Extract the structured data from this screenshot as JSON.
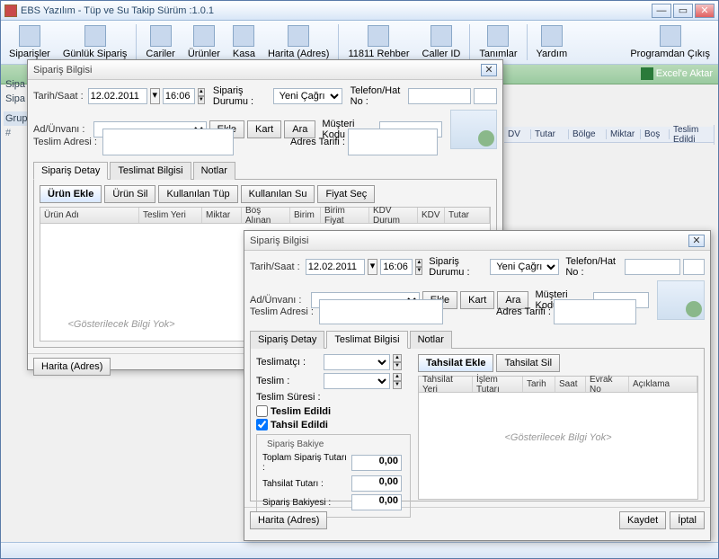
{
  "app": {
    "title": "EBS Yazılım - Tüp ve Su Takip Sürüm :1.0.1"
  },
  "toolbar": {
    "items": [
      "Siparişler",
      "Günlük Sipariş",
      "Cariler",
      "Ürünler",
      "Kasa",
      "Harita (Adres)",
      "11811 Rehber",
      "Caller ID",
      "Tanımlar",
      "Yardım"
    ],
    "rightItem": "Programdan Çıkış",
    "excelExport": "Excel'e Aktar"
  },
  "sidebar": {
    "rows": [
      "Sipa",
      "Sipa",
      "Grup"
    ],
    "hash": "#"
  },
  "gridColumns": [
    "DV",
    "Tutar",
    "Bölge",
    "Miktar",
    "Boş",
    "Teslim Edildi"
  ],
  "orderDialog": {
    "title": "Sipariş Bilgisi",
    "labels": {
      "dateTime": "Tarih/Saat :",
      "nameTitle": "Ad/Ünvanı :",
      "deliveryAddr": "Teslim Adresi :",
      "orderStatus": "Sipariş Durumu :",
      "phone": "Telefon/Hat No :",
      "customerCode": "Müşteri Kodu :",
      "addressDesc": "Adres Tarifi :"
    },
    "date": "12.02.2011",
    "time": "16:06",
    "status": "Yeni Çağrı",
    "btns": {
      "add": "Ekle",
      "card": "Kart",
      "search": "Ara"
    },
    "tabs": [
      "Sipariş Detay",
      "Teslimat Bilgisi",
      "Notlar"
    ],
    "detailBtns": [
      "Ürün Ekle",
      "Ürün Sil",
      "Kullanılan Tüp",
      "Kullanılan Su",
      "Fiyat Seç"
    ],
    "detailCols": [
      "Ürün Adı",
      "Teslim Yeri",
      "Miktar",
      "Boş Alınan",
      "Birim",
      "Birim Fiyat",
      "KDV Durum",
      "KDV",
      "Tutar"
    ],
    "noData": "<Gösterilecek Bilgi Yok>",
    "footerBtn": "Harita (Adres)"
  },
  "deliveryDialog": {
    "title": "Sipariş Bilgisi",
    "activeTab": "Teslimat Bilgisi",
    "labels": {
      "courier": "Teslimatçı :",
      "delivery": "Teslim :",
      "duration": "Teslim Süresi :",
      "delivered": "Teslim Edildi",
      "collected": "Tahsil Edildi",
      "balanceTitle": "Sipariş Bakiye",
      "totalOrder": "Toplam Sipariş Tutarı :",
      "collectAmt": "Tahsilat Tutarı :",
      "orderBal": "Sipariş Bakiyesi :"
    },
    "amounts": {
      "total": "0,00",
      "collect": "0,00",
      "balance": "0,00"
    },
    "collectBtns": {
      "add": "Tahsilat Ekle",
      "del": "Tahsilat Sil"
    },
    "collectCols": [
      "Tahsilat Yeri",
      "İşlem Tutarı",
      "Tarih",
      "Saat",
      "Evrak No",
      "Açıklama"
    ],
    "footBtns": {
      "map": "Harita (Adres)",
      "save": "Kaydet",
      "cancel": "İptal"
    }
  }
}
